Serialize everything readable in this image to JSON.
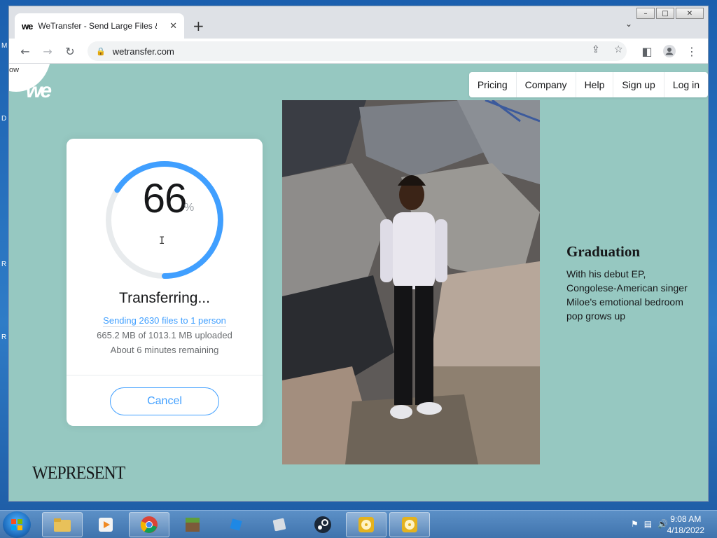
{
  "desktop": {
    "side_letters": [
      "M",
      "D",
      "R",
      "R"
    ]
  },
  "browser": {
    "tab": {
      "favicon": "we",
      "title": "WeTransfer - Send Large Files & S"
    },
    "url": "wetransfer.com"
  },
  "logo": {
    "partial_text": "ow"
  },
  "nav": {
    "items": [
      "Pricing",
      "Company",
      "Help",
      "Sign up",
      "Log in"
    ]
  },
  "transfer": {
    "percent": 66,
    "percent_sign": "%",
    "status": "Transferring...",
    "send_info": "Sending 2630 files to 1 person",
    "size_info": "665.2 MB of 1013.1 MB uploaded",
    "remaining": "About 6 minutes remaining",
    "cancel_label": "Cancel",
    "ring_color": "#409fff",
    "ring_track_color": "#e8ebed"
  },
  "story": {
    "title": "Graduation",
    "text": "With his debut EP, Congolese-American singer Miloe's emotional bedroom pop grows up"
  },
  "wepresent": "WEPRESENT",
  "clock": {
    "time": "9:08 AM",
    "date": "4/18/2022"
  },
  "colors": {
    "page_bg": "#96c8c1",
    "accent": "#409fff"
  }
}
